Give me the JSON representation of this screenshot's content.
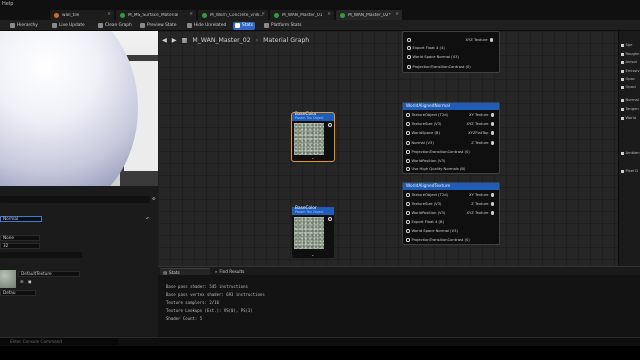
{
  "menubar": {
    "help_label": "Help"
  },
  "tabs": [
    {
      "label": "wall_tile",
      "dot": "#d26b2b"
    },
    {
      "label": "M_MS_Surface_Material",
      "dot": "#2f9d3b"
    },
    {
      "label": "M_Worn_Concrete_vnlk...",
      "dot": "#2f9d3b"
    },
    {
      "label": "M_WAN_Master_01",
      "dot": "#2f9d3b"
    },
    {
      "label": "M_WAN_Master_02*",
      "dot": "#2f9d3b"
    }
  ],
  "toolbar": {
    "hierarchy": "Hierarchy",
    "live_update": "Live Update",
    "clean_graph": "Clean Graph",
    "preview_state": "Preview State",
    "hide_unrelated": "Hide Unrelated",
    "stats": "Stats",
    "platform_stats": "Platform Stats"
  },
  "graph": {
    "breadcrumb_asset": "M_WAN_Master_02",
    "breadcrumb_graph": "Material Graph"
  },
  "node_top": {
    "pins": [
      "Export Float 4 (4)",
      "World Space Normal (V3)",
      "ProjectionTransitionContrast (S)"
    ],
    "right_pin": "XYZ Texture"
  },
  "node_normal": {
    "title": "WorldAlignedNormal",
    "inputs": [
      "TextureObject (T2d)",
      "TextureSize (V3)",
      "WorldSpace (B)",
      "Normal (V3)",
      "ProjectionTransitionContrast (S)",
      "WorldPosition (V3)",
      "Use High Quality Normals (B)"
    ],
    "outputs": [
      "XY Texture",
      "XYZ Texture",
      "XYZFlatTop",
      "Z Texture"
    ]
  },
  "node_texture": {
    "title": "WorldAlignedTexture",
    "inputs": [
      "TextureObject (T2d)",
      "TextureSize (V3)",
      "WorldPosition (V3)",
      "Export Float 4 (B)",
      "World Space Normal (V3)",
      "ProjectionTransitionContrast (S)"
    ],
    "outputs": [
      "XY Texture",
      "Z Texture",
      "XYZ Texture"
    ]
  },
  "tex_node_1": {
    "title": "BaseColor",
    "sub": "Param Tex Object"
  },
  "tex_node_2": {
    "title": "BaseColor",
    "sub": "Param Tex Object"
  },
  "right_panel": {
    "items": [
      "Spe",
      "Roughn",
      "Anisot",
      "Emissiv",
      "Opac",
      "Opaci",
      "Normal",
      "Tangen",
      "World",
      "Ambien",
      "Pixel D"
    ]
  },
  "details": {
    "name_value": "Normal",
    "row1_value": "None",
    "row2_value": "32",
    "texture_select": "DefaultTexture",
    "bottom_select": "Defau"
  },
  "stats": {
    "tab_stats": "Stats",
    "tab_find": "Find Results",
    "lines": [
      "Base pass shader: 545 instructions",
      "Base pass vertex shader: 693 instructions",
      "Texture samplers: 2/16",
      "Texture Lookups (Est.): VS(0), PS(3)",
      "Shader Count: 5"
    ]
  },
  "console": {
    "placeholder": "Enter Console Command"
  },
  "colors": {
    "accent": "#2e68c6",
    "selection": "#e89521",
    "node_header": "#1f5db8"
  }
}
